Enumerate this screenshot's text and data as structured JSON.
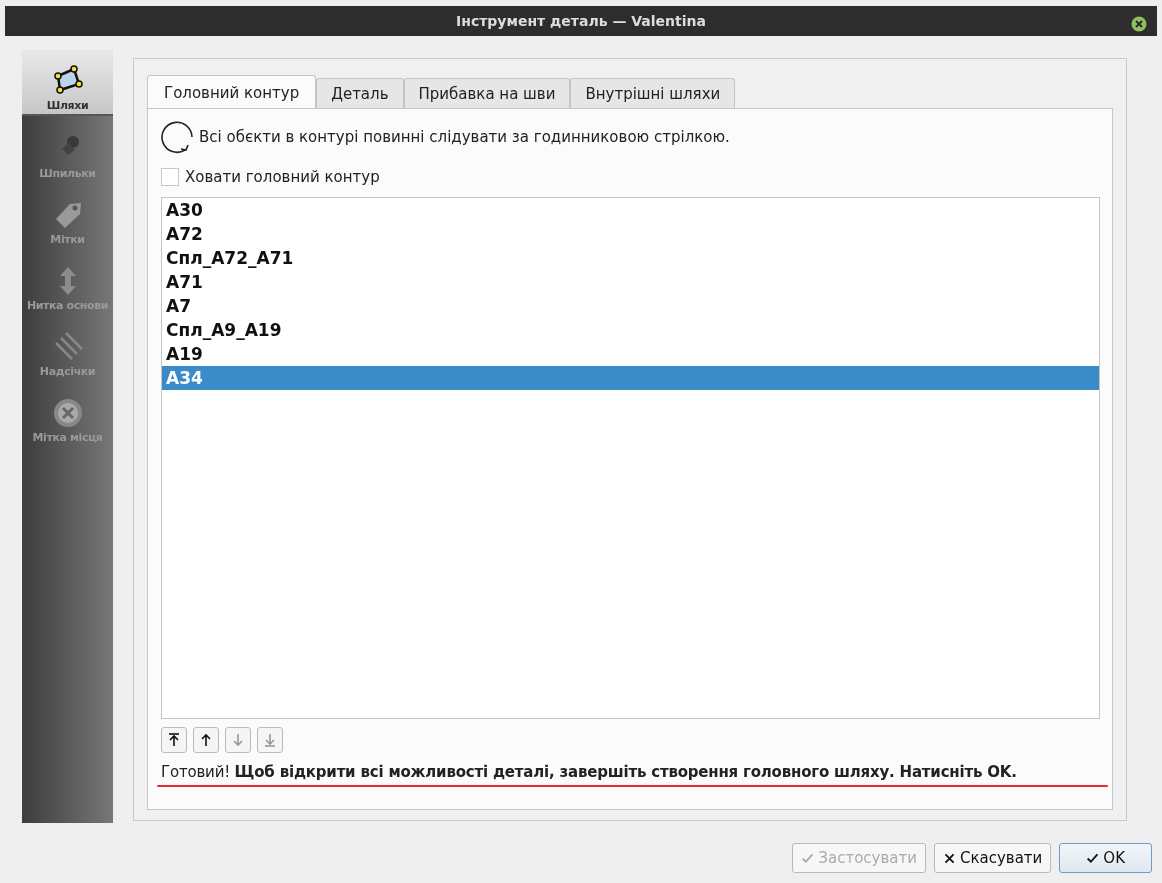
{
  "window": {
    "title": "Інструмент деталь — Valentina"
  },
  "sidebar": {
    "items": [
      {
        "label": "Шляхи",
        "kind": "path",
        "selected": true
      },
      {
        "label": "Шпильки",
        "kind": "pin",
        "selected": false
      },
      {
        "label": "Мітки",
        "kind": "label",
        "selected": false
      },
      {
        "label": "Нитка основи",
        "kind": "grainline",
        "selected": false
      },
      {
        "label": "Надсічки",
        "kind": "notch",
        "selected": false
      },
      {
        "label": "Мітка місця",
        "kind": "placemark",
        "selected": false
      }
    ]
  },
  "tabs": [
    {
      "label": "Головний контур",
      "selected": true
    },
    {
      "label": "Деталь",
      "selected": false
    },
    {
      "label": "Прибавка на шви",
      "selected": false
    },
    {
      "label": "Внутрішні шляхи",
      "selected": false
    }
  ],
  "hint": "Всі обєкти в контурі повинні слідувати за годинниковою стрілкою.",
  "hide_checkbox": {
    "label": "Ховати головний контур",
    "checked": false
  },
  "list": [
    {
      "label": "A30",
      "selected": false
    },
    {
      "label": "A72",
      "selected": false
    },
    {
      "label": "Спл_A72_A71",
      "selected": false
    },
    {
      "label": "A71",
      "selected": false
    },
    {
      "label": "A7",
      "selected": false
    },
    {
      "label": "Спл_A9_A19",
      "selected": false
    },
    {
      "label": "A19",
      "selected": false
    },
    {
      "label": "A34",
      "selected": true
    }
  ],
  "move_buttons": [
    {
      "kind": "top",
      "disabled": false
    },
    {
      "kind": "up",
      "disabled": false
    },
    {
      "kind": "down",
      "disabled": true
    },
    {
      "kind": "bottom",
      "disabled": true
    }
  ],
  "status": {
    "text": "Готовий! **Щоб відкрити всі можливості деталі, завершіть створення головного шляху. Натисніть OK.**",
    "underlined": true
  },
  "buttons": [
    {
      "label": "Застосувати",
      "kind": "check",
      "disabled": true,
      "default": false
    },
    {
      "label": "Скасувати",
      "kind": "cross",
      "disabled": false,
      "default": false
    },
    {
      "label": "OK",
      "kind": "check",
      "disabled": false,
      "default": true
    }
  ]
}
